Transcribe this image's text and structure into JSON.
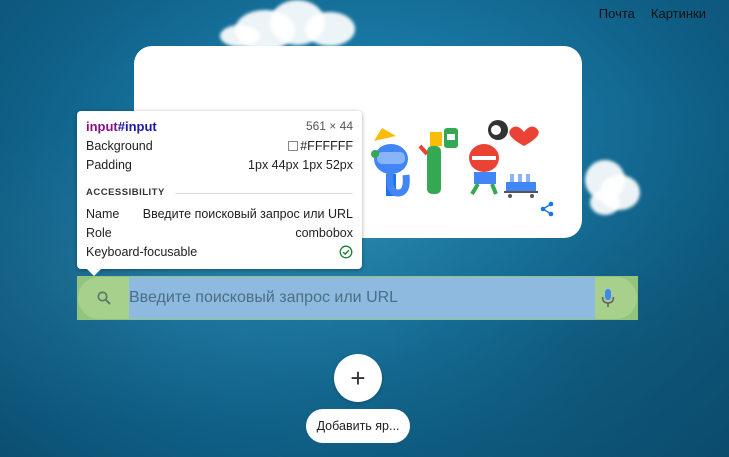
{
  "top_links": {
    "mail": "Почта",
    "images": "Картинки"
  },
  "inspector": {
    "element_tag": "input",
    "element_id": "#input",
    "dimensions": "561 × 44",
    "background_label": "Background",
    "background_value": "#FFFFFF",
    "padding_label": "Padding",
    "padding_value": "1px 44px 1px 52px",
    "section_title": "ACCESSIBILITY",
    "name_label": "Name",
    "name_value": "Введите поисковый запрос или URL",
    "role_label": "Role",
    "role_value": "combobox",
    "keyboard_label": "Keyboard-focusable"
  },
  "search": {
    "placeholder": "Введите поисковый запрос или URL"
  },
  "shortcut": {
    "add_label": "Добавить яр..."
  },
  "colors": {
    "search_highlight": "#93c47d",
    "content_highlight": "#8fbadf",
    "background": "#1878a3"
  },
  "icons": [
    "search-icon",
    "mic-icon",
    "share-icon",
    "check-icon",
    "plus-icon",
    "heart-icon"
  ]
}
